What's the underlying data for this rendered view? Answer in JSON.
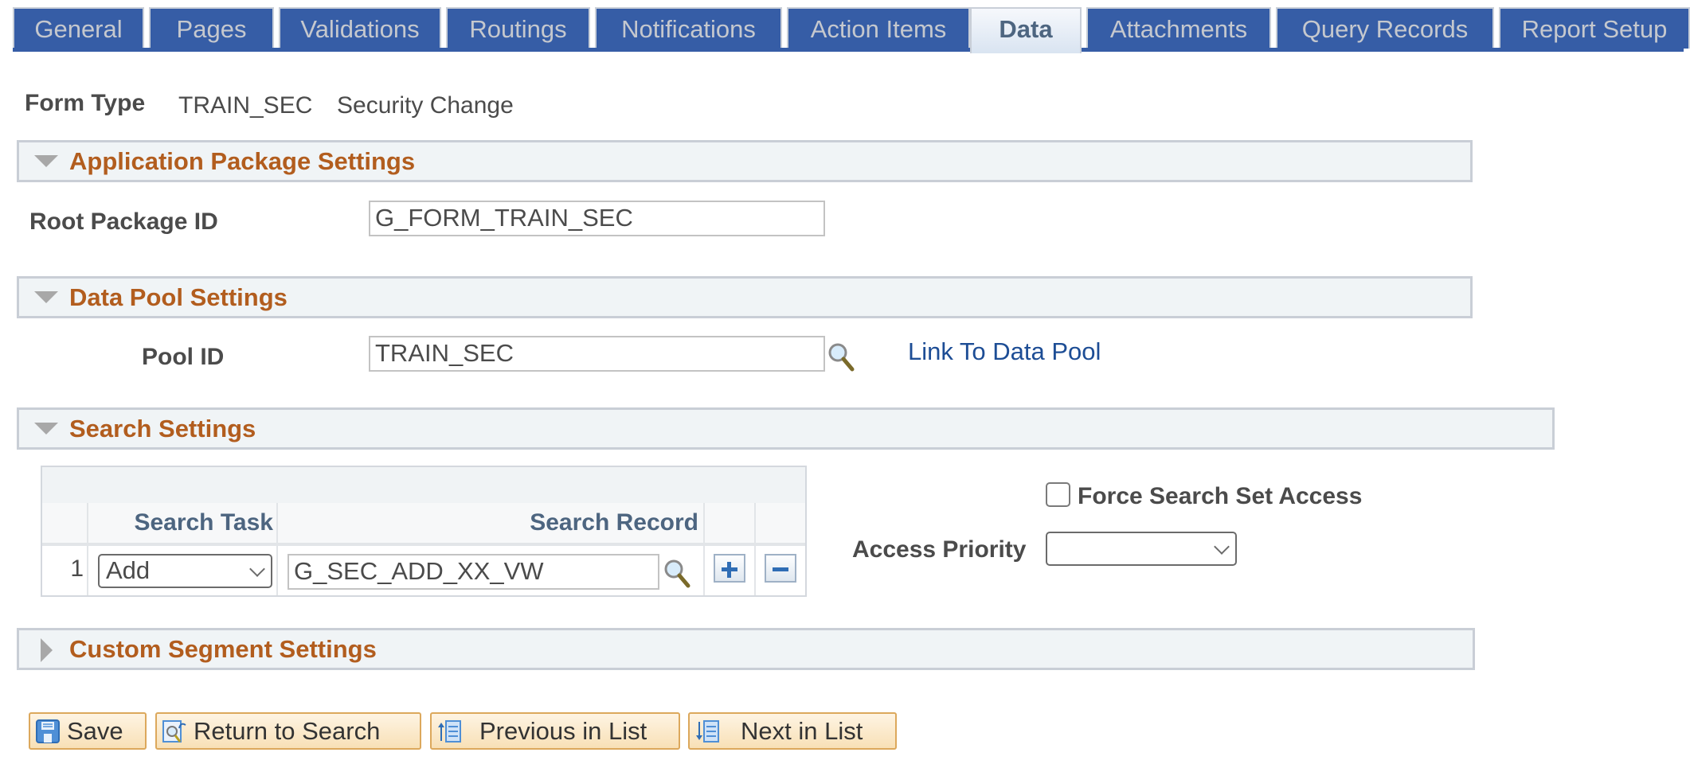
{
  "tabs": [
    {
      "label": "General",
      "active": false
    },
    {
      "label": "Pages",
      "active": false
    },
    {
      "label": "Validations",
      "active": false
    },
    {
      "label": "Routings",
      "active": false
    },
    {
      "label": "Notifications",
      "active": false
    },
    {
      "label": "Action Items",
      "active": false
    },
    {
      "label": "Data",
      "active": true
    },
    {
      "label": "Attachments",
      "active": false
    },
    {
      "label": "Query Records",
      "active": false
    },
    {
      "label": "Report Setup",
      "active": false
    }
  ],
  "form_type": {
    "label": "Form Type",
    "code": "TRAIN_SEC",
    "description": "Security Change"
  },
  "sections": {
    "app_package": {
      "title": "Application Package Settings",
      "expanded": true,
      "root_package_label": "Root Package ID",
      "root_package_value": "G_FORM_TRAIN_SEC"
    },
    "data_pool": {
      "title": "Data Pool Settings",
      "expanded": true,
      "pool_id_label": "Pool ID",
      "pool_id_value": "TRAIN_SEC",
      "link_label": "Link To Data Pool"
    },
    "search": {
      "title": "Search Settings",
      "expanded": true,
      "grid": {
        "columns": [
          "Search Task",
          "Search Record"
        ],
        "rows": [
          {
            "num": "1",
            "task": "Add",
            "record": "G_SEC_ADD_XX_VW"
          }
        ]
      },
      "force_search_label": "Force Search Set Access",
      "force_search_checked": false,
      "access_priority_label": "Access Priority",
      "access_priority_value": ""
    },
    "custom_segment": {
      "title": "Custom Segment Settings",
      "expanded": false
    }
  },
  "toolbar": {
    "save_label": "Save",
    "return_label": "Return to Search",
    "previous_label": "Previous in List",
    "next_label": "Next in List"
  },
  "colors": {
    "tab_bg": "#365da6",
    "section_title": "#b25d1e",
    "link": "#1d4d95",
    "grid_header_text": "#4d6580"
  }
}
